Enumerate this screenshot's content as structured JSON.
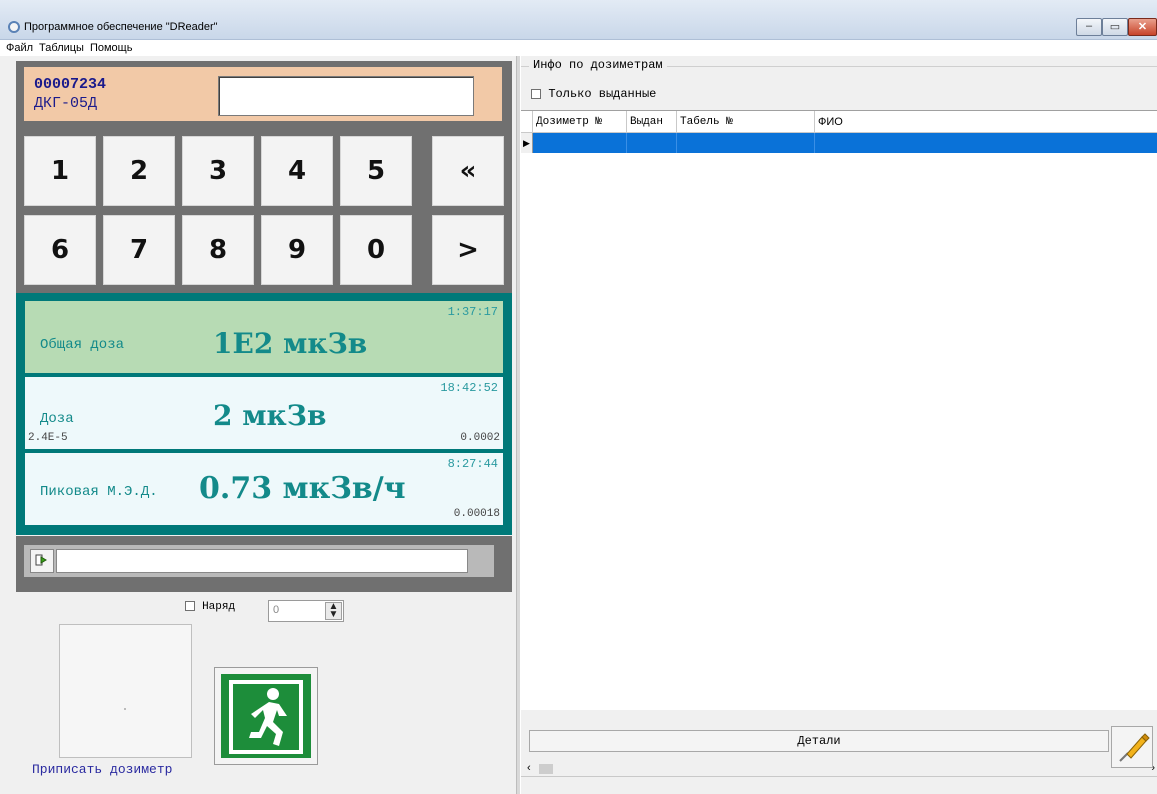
{
  "window": {
    "title": "Программное обеспечение \"DReader\"",
    "btn_min": "‒",
    "btn_max": "▭",
    "btn_close": "✕"
  },
  "menu": [
    "Файл",
    "Таблицы",
    "Помощь"
  ],
  "dosimeter": {
    "number": "00007234",
    "type": "ДКГ-05Д",
    "input_value": ""
  },
  "keypad": {
    "keys": [
      "1",
      "2",
      "3",
      "4",
      "5",
      "6",
      "7",
      "8",
      "9",
      "0"
    ],
    "backspace": "«",
    "enter": ">"
  },
  "total_dose": {
    "label": "Общая доза",
    "value": "1E2 мкЗв",
    "time": "1:37:17"
  },
  "dose": {
    "label": "Доза",
    "value": "2 мкЗв",
    "time": "18:42:52",
    "left_small": "2.4E-5",
    "right_small": "0.0002"
  },
  "peak": {
    "label": "Пиковая М.Э.Д.",
    "value": "0.73 мкЗв/ч",
    "time": "8:27:44",
    "right_small": "0.00018"
  },
  "command": {
    "input_value": ""
  },
  "naryad": {
    "label": "Наряд",
    "spin_value": "0"
  },
  "assign_label": "Приписать дозиметр",
  "info_panel": {
    "group_title": "Инфо по дозиметрам",
    "only_issued_label": "Только выданные",
    "columns": [
      "Дозиметр №",
      "Выдан",
      "Табель №",
      "ФИО"
    ],
    "details_label": "Детали",
    "scroll_left": "‹",
    "scroll_right": "›",
    "row_indicator": "▶"
  },
  "colors": {
    "accent_teal": "#007979",
    "id_panel": "#f2c9a7",
    "selected_row": "#0a72d8",
    "total_dose_bg": "#b7dbb4"
  }
}
